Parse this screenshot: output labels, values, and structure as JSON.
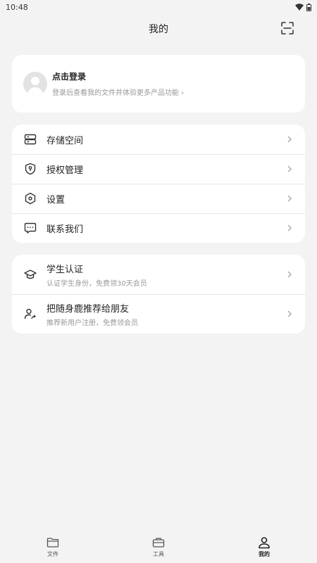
{
  "status_bar": {
    "time": "10:48"
  },
  "header": {
    "title": "我的"
  },
  "login": {
    "title": "点击登录",
    "subtitle": "登录后查看我的文件并体验更多产品功能 ›"
  },
  "menu": [
    {
      "label": "存储空间",
      "icon": "storage-icon"
    },
    {
      "label": "授权管理",
      "icon": "shield-icon"
    },
    {
      "label": "设置",
      "icon": "settings-icon"
    },
    {
      "label": "联系我们",
      "icon": "chat-icon"
    }
  ],
  "promo": [
    {
      "title": "学生认证",
      "subtitle": "认证学生身份，免费领30天会员",
      "icon": "graduation-cap-icon"
    },
    {
      "title": "把随身鹿推荐给朋友",
      "subtitle": "推荐新用户注册，免费领会员",
      "icon": "share-user-icon"
    }
  ],
  "tabs": [
    {
      "label": "文件",
      "icon": "folder-icon"
    },
    {
      "label": "工具",
      "icon": "toolbox-icon"
    },
    {
      "label": "我的",
      "icon": "profile-icon",
      "active": true
    }
  ]
}
